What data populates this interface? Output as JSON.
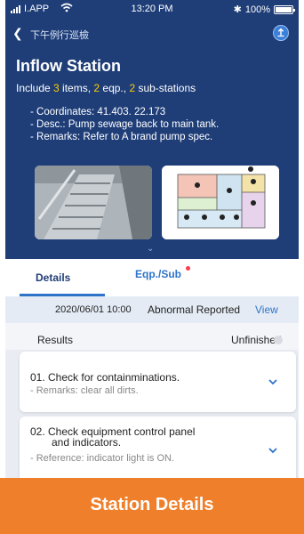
{
  "status_bar": {
    "carrier": "I.APP",
    "time": "13:20 PM",
    "battery": "100%",
    "battery_level": 1.0
  },
  "navbar": {
    "title": "下午例行巡檢",
    "back_icon": "back-chevron-icon",
    "action_icon": "upload-icon"
  },
  "station": {
    "name": "Inflow Station",
    "summary": {
      "prefix": "Include ",
      "items_count": "3",
      "items_label": " items, ",
      "eqp_count": "2",
      "eqp_label": " eqp., ",
      "sub_count": "2",
      "sub_label": " sub-stations"
    },
    "info": [
      "- Coordinates: 41.403. 22.173",
      "- Desc.: Pump sewage back to main tank.",
      "- Remarks: Refer to A brand pump spec."
    ]
  },
  "tabs": [
    {
      "label": "Details",
      "active": true
    },
    {
      "label": "Eqp./Sub",
      "active": false,
      "has_badge": true
    }
  ],
  "report": {
    "datetime": "2020/06/01 10:00",
    "status": "Abnormal Reported",
    "view_label": "View"
  },
  "results": {
    "label": "Results",
    "state": "Unfinished",
    "items": [
      {
        "title": "01. Check for containminations.",
        "sub": "- Remarks: clear all dirts."
      },
      {
        "title": "02. Check equipment control panel",
        "title2": "and indicators.",
        "sub": "- Reference: indicator light is ON."
      }
    ]
  },
  "overlay": {
    "label": "Station Details"
  },
  "colors": {
    "header_bg": "#1f3e78",
    "accent": "#2d74c8",
    "highlight": "#ffcc00",
    "badge": "#ff3b4e",
    "overlay_bg": "#ef7f2b"
  }
}
